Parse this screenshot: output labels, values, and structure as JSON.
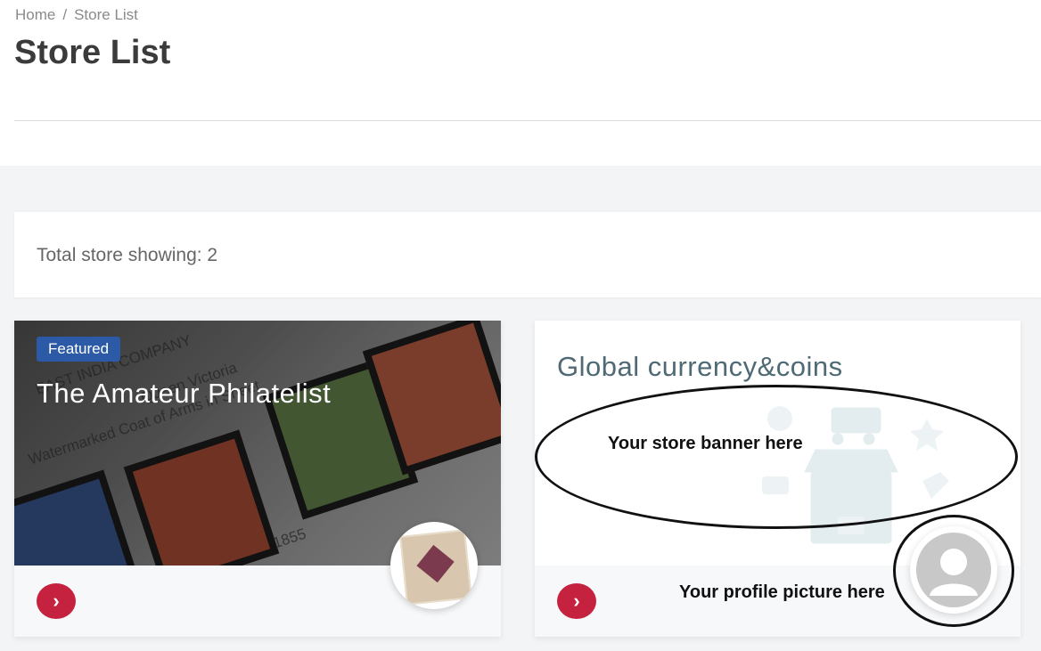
{
  "breadcrumb": {
    "home": "Home",
    "separator": "/",
    "current": "Store List"
  },
  "page_title": "Store List",
  "store_count": {
    "text": "Total store showing: 2"
  },
  "stores": [
    {
      "badge": "Featured",
      "name": "The Amateur Philatelist",
      "photo_text": [
        "EAST INDIA COMPANY",
        "Queen Victoria",
        "Watermarked Coat of Arms in Sheet",
        "1855"
      ]
    },
    {
      "name": "Global currency&coins",
      "banner_annotation": "Your store banner here",
      "profile_annotation": "Your profile picture here"
    }
  ],
  "icons": {
    "arrow": "chevron-right-icon",
    "cart": "shopping-cart-icon",
    "basket": "basket-icon",
    "star": "star-icon",
    "cup": "coffee-cup-icon",
    "tag": "tag-icon",
    "store": "storefront-icon"
  },
  "colors": {
    "accent": "#c4223f",
    "badge": "#2d5aa6",
    "title2": "#4f6a75"
  }
}
